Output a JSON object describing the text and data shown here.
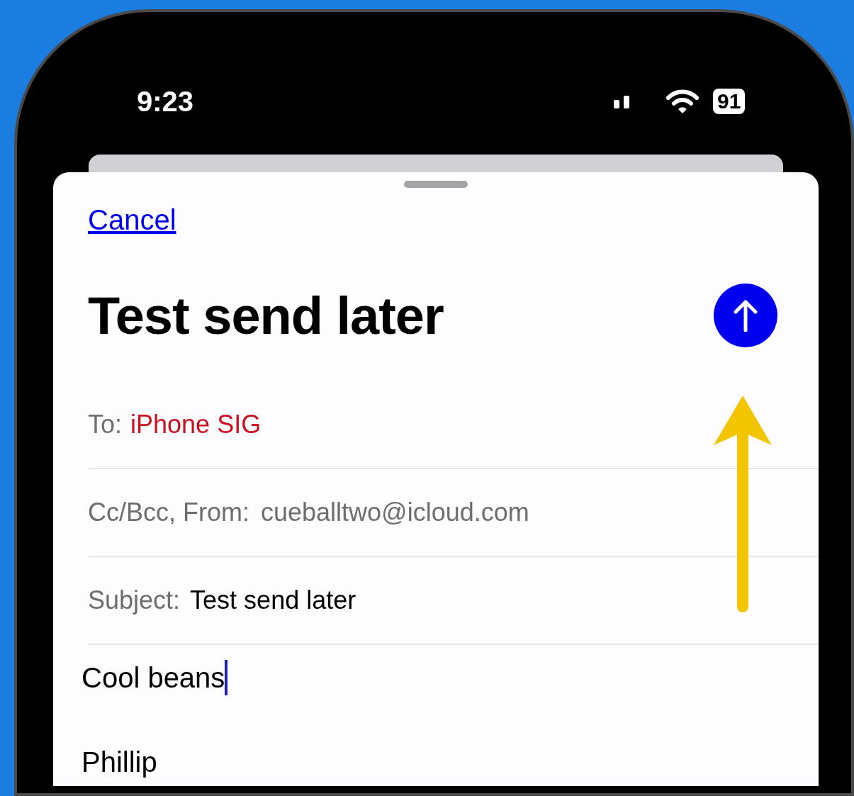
{
  "status_bar": {
    "time": "9:23",
    "battery": "91"
  },
  "compose": {
    "cancel": "Cancel",
    "title": "Test send later",
    "to": {
      "label": "To:",
      "recipient": "iPhone SIG"
    },
    "cc_from": {
      "label": "Cc/Bcc, From:",
      "value": "cueballtwo@icloud.com"
    },
    "subject": {
      "label": "Subject:",
      "value": "Test send later"
    },
    "body_lines": [
      "Cool beans",
      "Phillip"
    ]
  }
}
